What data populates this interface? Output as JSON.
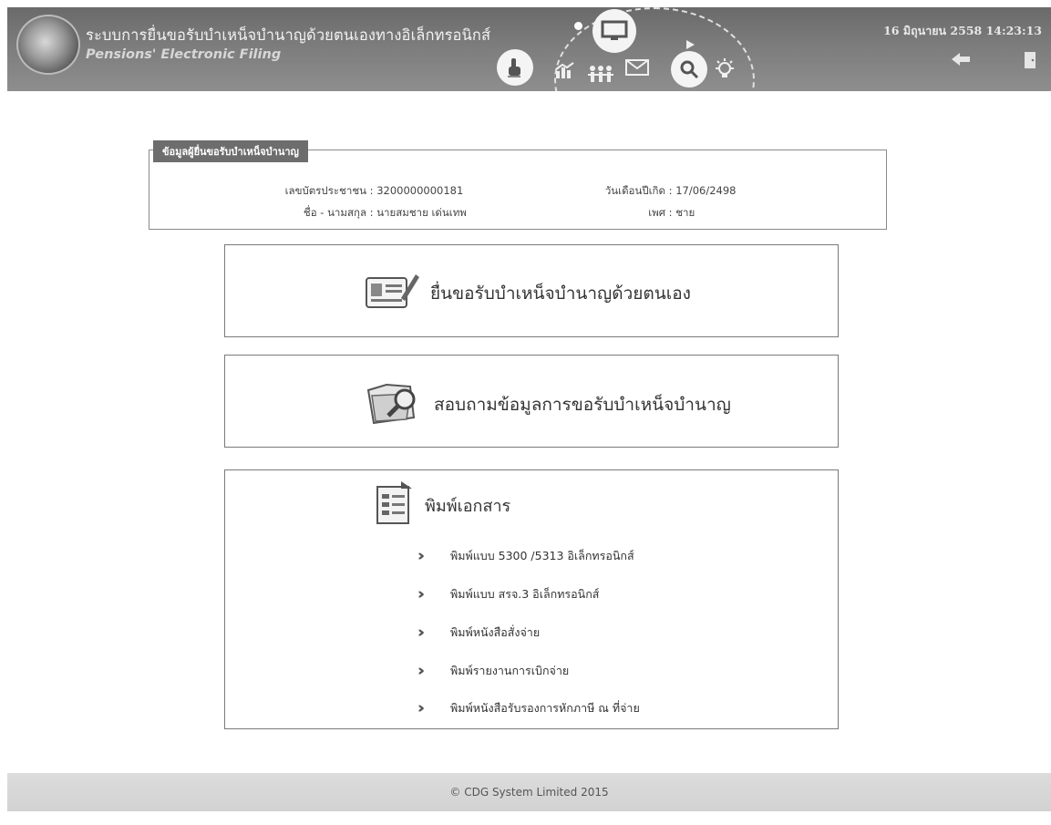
{
  "header": {
    "title_th": "ระบบการยื่นขอรับบำเหน็จบำนาญด้วยตนเองทางอิเล็กทรอนิกส์",
    "title_en": "Pensions' Electronic Filing",
    "datetime": "16 มิถุนายน 2558 14:23:13",
    "icons": [
      "seal-logo",
      "touch-icon",
      "chart-icon",
      "people-icon",
      "mail-icon",
      "monitor-icon",
      "search-icon",
      "lightbulb-icon",
      "back-icon",
      "exit-door-icon"
    ]
  },
  "applicant": {
    "legend": "ข้อมูลผู้ยื่นขอรับบำเหน็จบำนาญ",
    "id_label": "เลขบัตรประชาชน",
    "id_value": "3200000000181",
    "name_label": "ชื่อ - นามสกุล",
    "name_value": "นายสมชาย เด่นเทพ",
    "dob_label": "วันเดือนปีเกิด",
    "dob_value": "17/06/2498",
    "sex_label": "เพศ",
    "sex_value": "ชาย"
  },
  "menu": {
    "file_label": "ยื่นขอรับบำเหน็จบำนาญด้วยตนเอง",
    "inquiry_label": "สอบถามข้อมูลการขอรับบำเหน็จบำนาญ",
    "print_label": "พิมพ์เอกสาร",
    "print_items": [
      "พิมพ์แบบ 5300 /5313 อิเล็กทรอนิกส์",
      "พิมพ์แบบ สรจ.3 อิเล็กทรอนิกส์",
      "พิมพ์หนังสือสั่งจ่าย",
      "พิมพ์รายงานการเบิกจ่าย",
      "พิมพ์หนังสือรับรองการหักภาษี ณ ที่จ่าย"
    ]
  },
  "footer": {
    "copyright": "© CDG System Limited 2015"
  }
}
